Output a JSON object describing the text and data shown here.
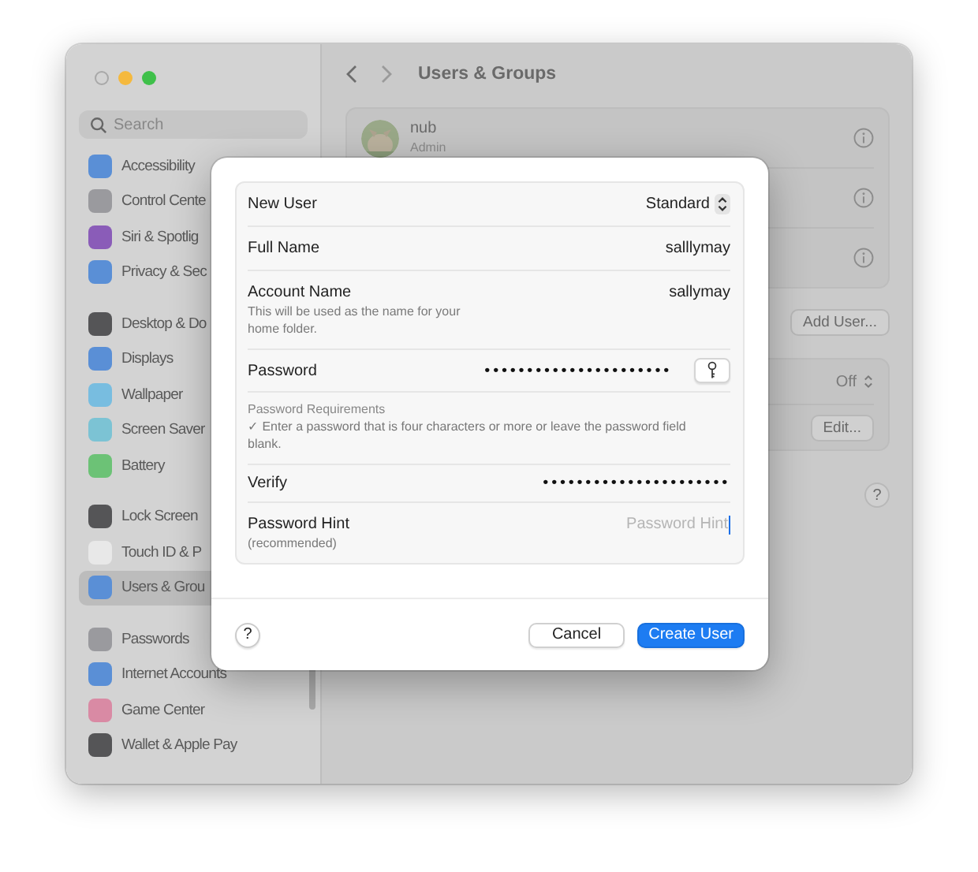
{
  "window": {
    "title": "Users & Groups"
  },
  "sidebar": {
    "search": {
      "placeholder": "Search"
    },
    "groups": [
      [
        {
          "label": "Accessibility",
          "color": "#5a8fd6",
          "selected": false
        },
        {
          "label": "Control Cente",
          "color": "#9a9a9e",
          "selected": false
        },
        {
          "label": "Siri & Spotlig",
          "color": "#8a5cb8",
          "selected": false
        },
        {
          "label": "Privacy & Sec",
          "color": "#5a8fd6",
          "selected": false
        }
      ],
      [
        {
          "label": "Desktop & Do",
          "color": "#555557",
          "selected": false
        },
        {
          "label": "Displays",
          "color": "#5a8fd6",
          "selected": false
        },
        {
          "label": "Wallpaper",
          "color": "#78bde0",
          "selected": false
        },
        {
          "label": "Screen Saver",
          "color": "#7cc3d4",
          "selected": false
        },
        {
          "label": "Battery",
          "color": "#6cc276",
          "selected": false
        }
      ],
      [
        {
          "label": "Lock Screen",
          "color": "#555557",
          "selected": false
        },
        {
          "label": "Touch ID & P",
          "color": "#e8e8e8",
          "selected": false
        },
        {
          "label": "Users & Grou",
          "color": "#5a8fd6",
          "selected": true
        }
      ],
      [
        {
          "label": "Passwords",
          "color": "#9a9a9e",
          "selected": false
        },
        {
          "label": "Internet Accounts",
          "color": "#5a8fd6",
          "selected": false
        },
        {
          "label": "Game Center",
          "color": "#d98aa4",
          "selected": false
        },
        {
          "label": "Wallet & Apple Pay",
          "color": "#555557",
          "selected": false
        }
      ]
    ]
  },
  "users": [
    {
      "name": "nub",
      "role": "Admin",
      "kind": "picture",
      "info_button": true
    },
    {
      "info_button": true
    },
    {
      "info_button": true
    }
  ],
  "user_buttons": [
    "Add User..."
  ],
  "settings_rows": [
    {
      "kind": "popup",
      "value": "Off"
    },
    {
      "kind": "button",
      "label": "Edit..."
    }
  ],
  "help": "?",
  "dialog": {
    "rows": [
      {
        "kind": "popup",
        "label": "New User",
        "value": "Standard"
      },
      {
        "kind": "text",
        "label": "Full Name",
        "value": "salllymay"
      },
      {
        "kind": "text",
        "label": "Account Name",
        "note": "This will be used as the name for your home folder.",
        "value": "sallymay"
      },
      {
        "kind": "password",
        "label": "Password",
        "value": "••••••••••••••••••••••",
        "key_button": true
      },
      {
        "kind": "info",
        "title": "Password Requirements",
        "text": "✓ Enter a password that is four characters or more or leave the password field blank."
      },
      {
        "kind": "password",
        "label": "Verify",
        "value": "••••••••••••••••••••••"
      },
      {
        "kind": "input",
        "label": "Password Hint",
        "note": "(recommended)",
        "placeholder": "Password Hint",
        "focused": true
      }
    ],
    "help": "?",
    "buttons": [
      {
        "label": "Cancel",
        "default": false
      },
      {
        "label": "Create User",
        "default": true
      }
    ]
  }
}
